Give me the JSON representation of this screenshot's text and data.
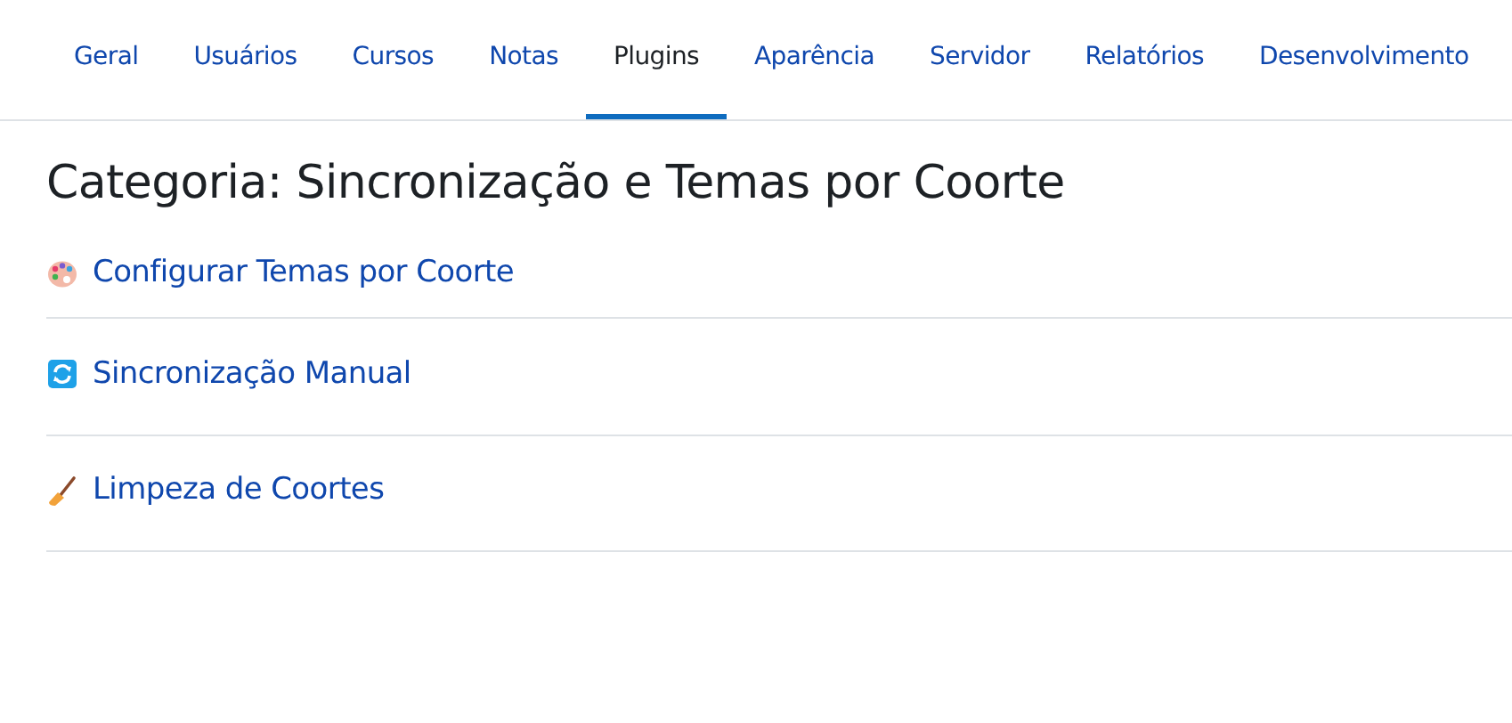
{
  "tabs": [
    {
      "label": "Geral",
      "selected": false
    },
    {
      "label": "Usuários",
      "selected": false
    },
    {
      "label": "Cursos",
      "selected": false
    },
    {
      "label": "Notas",
      "selected": false
    },
    {
      "label": "Plugins",
      "selected": true
    },
    {
      "label": "Aparência",
      "selected": false
    },
    {
      "label": "Servidor",
      "selected": false
    },
    {
      "label": "Relatórios",
      "selected": false
    },
    {
      "label": "Desenvolvimento",
      "selected": false
    }
  ],
  "heading": "Categoria: Sincronização e Temas por Coorte",
  "links": [
    {
      "kind": "palette",
      "label": "Configurar Temas por Coorte"
    },
    {
      "kind": "sync",
      "label": "Sincronização Manual"
    },
    {
      "kind": "broom",
      "label": "Limpeza de Coortes"
    }
  ]
}
